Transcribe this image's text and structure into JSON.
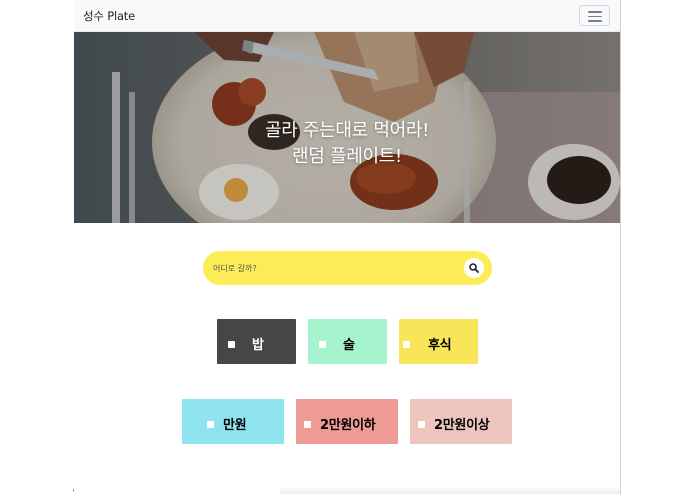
{
  "navbar": {
    "brand": "성수 Plate",
    "toggler_icon": "hamburger-icon"
  },
  "hero": {
    "line1": "골라 주는대로 먹어라!",
    "line2": "랜덤 플레이트!"
  },
  "search": {
    "placeholder": "어디로 갈까?",
    "icon": "search-icon",
    "bg_color": "#fced56"
  },
  "categories": {
    "row1": [
      {
        "label": "밥",
        "bg": "#464646",
        "text_color": "#ffffff"
      },
      {
        "label": "술",
        "bg": "#a6f4cf",
        "text_color": "#000000"
      },
      {
        "label": "후식",
        "bg": "#f8e559",
        "text_color": "#000000"
      }
    ],
    "row2": [
      {
        "label": "만원",
        "bg": "#8ee3ef",
        "text_color": "#000000"
      },
      {
        "label": "2만원이하",
        "bg": "#ee9a95",
        "text_color": "#000000"
      },
      {
        "label": "2만원이상",
        "bg": "#edc5bc",
        "text_color": "#000000"
      }
    ]
  }
}
